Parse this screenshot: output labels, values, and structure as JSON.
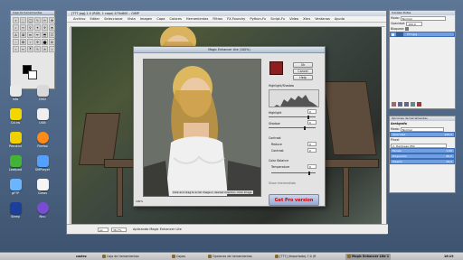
{
  "toolbox": {
    "title": "Caja de herramientas",
    "tools": [
      "⌖",
      "⬚",
      "◯",
      "✎",
      "✂",
      "✥",
      "⌕",
      "↔",
      "⚲",
      "✦",
      "✢",
      "⬘",
      "A",
      "⌘",
      "⬌",
      "✒",
      "⬒",
      "☐",
      "♢",
      "✪",
      "✧",
      "✣",
      "⬤",
      "⊕",
      "⌁",
      "✂",
      "⦿",
      "✎",
      "✍",
      "✧"
    ]
  },
  "desktop": {
    "icons": [
      {
        "name": "Info",
        "icon": "info-icon",
        "color": "#e9e9e9"
      },
      {
        "name": "DVD",
        "icon": "dvd-icon",
        "color": "#d9d9d9"
      },
      {
        "name": "Cd-rw",
        "icon": "cd-rw-icon",
        "color": "#f3d800"
      },
      {
        "name": "USB",
        "icon": "usb-icon",
        "color": "#efefef"
      },
      {
        "name": "Pendrivl",
        "icon": "pendrive-icon",
        "color": "#f0d000"
      },
      {
        "name": "Firefox",
        "icon": "firefox-icon",
        "color": "#ff8b16"
      },
      {
        "name": "Leafpad",
        "icon": "leafpad-icon",
        "color": "#43b336"
      },
      {
        "name": "SMPlayer",
        "icon": "smplayer-icon",
        "color": "#53a0ff"
      },
      {
        "name": "gFTP",
        "icon": "gftp-icon",
        "color": "#6bb5ff"
      },
      {
        "name": "Claws",
        "icon": "claws-icon",
        "color": "#f5f5f5"
      },
      {
        "name": "Sleep",
        "icon": "sleep-icon",
        "color": "#1d3e9b"
      },
      {
        "name": "Nvu",
        "icon": "nvu-icon",
        "color": "#7a4cd6"
      }
    ]
  },
  "gimp": {
    "title": "[TT7.jpg]-1.0 (RGB, 1 capa) 470x800 – GIMP",
    "menu": [
      "Archivo",
      "Editar",
      "Seleccionar",
      "Vista",
      "Imagen",
      "Capa",
      "Colores",
      "Herramientas",
      "Filtros",
      "FX-Foundry",
      "Python-Fu",
      "Script-Fu",
      "Video",
      "Xtns",
      "Ventanas",
      "Ayuda"
    ],
    "status": {
      "unit": "px",
      "zoom": "36,7%",
      "message": "Aplicando Magic Enhancer Lite"
    }
  },
  "dialog": {
    "title": "Magic Enhancer Lite (100%)",
    "buttons": {
      "ok": "Ok",
      "cancel": "Cancel",
      "help": "Help"
    },
    "histogram_label": "Highlight/Shadow",
    "labels": {
      "highlight": "Highlight",
      "shadow": "Shadow",
      "contrast": "Contrast",
      "reduce": "Reduce",
      "contrast2": "Contrast",
      "color_balance": "Color Balance",
      "temperature": "Temperature",
      "show_values": "Show intermediate"
    },
    "values": {
      "highlight": "0",
      "shadow": "0",
      "reduce": "0",
      "contrast": "0",
      "temperature": "0"
    },
    "controls": {
      "highlight": 0.84,
      "shadow": 0.77,
      "temperature": 0.86
    },
    "preview_hint": "Click and drag to scroll image in desired direction. Click image",
    "zoom": "100%",
    "pro": "Get Pro version"
  },
  "layers": {
    "tab1": "Canales",
    "tab2": "Rutas",
    "mode_label": "Modo:",
    "mode": "Normal",
    "opacity_label": "Opacidad:",
    "opacity": "100,0",
    "lock_label": "Bloquear:",
    "layer": "TT7.jpg"
  },
  "tool_options": {
    "title": "Opciones de herramientas",
    "section": "Aerógrafo",
    "mode_label": "Modo:",
    "mode": "Normal",
    "opacity_label": "Opacidad",
    "opacity": "100,0",
    "brush_label": "Pincel",
    "brush": "2. Hardness 050",
    "scale_label": "Escala",
    "scale": "1,00",
    "rate_label": "Proporción",
    "rate": "80,0",
    "pressure_label": "Presión",
    "pressure": "10,0"
  },
  "taskbar": {
    "user": "castro",
    "items": [
      "Caja de herramientas",
      "Capas",
      "Opciones de herramientas",
      "[TT7] (Importado)-7.0 (R",
      "Magic Enhancer Lite 1"
    ],
    "time": "16:19"
  },
  "colors": {
    "accent": "#6fa0e6",
    "brand": "#d10000"
  }
}
